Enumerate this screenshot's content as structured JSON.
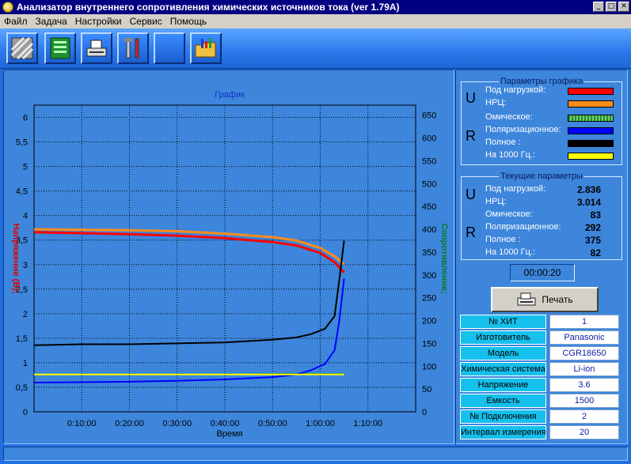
{
  "window": {
    "title": "Анализатор внутреннего сопротивления химических источников тока (ver 1.79А)"
  },
  "menu": [
    "Файл",
    "Задача",
    "Настройки",
    "Сервис",
    "Помощь"
  ],
  "toolbar": {
    "buttons": [
      "stripes-icon",
      "circuit-board-icon",
      "printer-fax-icon",
      "tools-icon",
      "blank-icon",
      "folder-chart-icon"
    ]
  },
  "graph": {
    "title": "График",
    "xlabel": "Время",
    "ylabel_left": "Напряжение (В);",
    "ylabel_right": "Сопротивление;"
  },
  "chart_data": {
    "type": "line",
    "title": "График",
    "xlabel": "Время",
    "ylabel": "Напряжение (В);",
    "y2label": "Сопротивление;",
    "x_ticks": [
      "0:10:00",
      "0:20:00",
      "0:30:00",
      "0:40:00",
      "0:50:00",
      "1:00:00",
      "1:10:00"
    ],
    "x_range_minutes": [
      0,
      80
    ],
    "y_ticks": [
      "0",
      "0,5",
      "1",
      "1,5",
      "2",
      "2,5",
      "3",
      "3,5",
      "4",
      "4,5",
      "5",
      "5,5",
      "6"
    ],
    "ylim": [
      0,
      6.25
    ],
    "y2_ticks": [
      "0",
      "50",
      "100",
      "150",
      "200",
      "250",
      "300",
      "350",
      "400",
      "450",
      "500",
      "550",
      "600",
      "650"
    ],
    "y2lim": [
      0,
      672
    ],
    "grid": true,
    "series": [
      {
        "name": "Под нагрузкой",
        "axis": "left",
        "color": "#ff0000",
        "x": [
          0,
          10,
          20,
          30,
          40,
          50,
          55,
          60,
          63,
          65
        ],
        "y": [
          3.66,
          3.64,
          3.62,
          3.59,
          3.54,
          3.46,
          3.39,
          3.24,
          3.05,
          2.84
        ]
      },
      {
        "name": "НРЦ",
        "axis": "left",
        "color": "#ff8c1a",
        "x": [
          0,
          10,
          20,
          30,
          40,
          50,
          55,
          60,
          63,
          65
        ],
        "y": [
          3.72,
          3.71,
          3.7,
          3.68,
          3.63,
          3.56,
          3.49,
          3.34,
          3.17,
          3.01
        ]
      },
      {
        "name": "Омическое",
        "axis": "right",
        "color": "#2a8a2a",
        "x": [
          0,
          10,
          20,
          30,
          40,
          50,
          60,
          65
        ],
        "y": [
          82,
          82,
          82,
          82,
          82,
          83,
          83,
          83
        ]
      },
      {
        "name": "Поляризационное",
        "axis": "right",
        "color": "#0000ff",
        "x": [
          0,
          10,
          20,
          30,
          40,
          50,
          55,
          58,
          61,
          63,
          64,
          65
        ],
        "y": [
          64,
          65,
          66,
          68,
          71,
          76,
          82,
          91,
          105,
          135,
          200,
          292
        ]
      },
      {
        "name": "Полное",
        "axis": "right",
        "color": "#000000",
        "x": [
          0,
          10,
          20,
          30,
          40,
          50,
          55,
          58,
          61,
          63,
          64,
          65
        ],
        "y": [
          146,
          148,
          148,
          150,
          152,
          158,
          163,
          170,
          182,
          210,
          290,
          375
        ]
      },
      {
        "name": "На 1000 Гц.",
        "axis": "right",
        "color": "#ffff00",
        "x": [
          0,
          10,
          20,
          30,
          40,
          50,
          60,
          65
        ],
        "y": [
          82,
          82,
          82,
          82,
          82,
          82,
          82,
          82
        ]
      }
    ]
  },
  "params_legend": {
    "title": "Параметры графика",
    "u": "U",
    "r": "R",
    "items": [
      {
        "label": "Под нагрузкой:",
        "color": "#ff0000"
      },
      {
        "label": "НРЦ:",
        "color": "#ff8c1a"
      },
      {
        "label": "Омическое:",
        "color": "#2a8a2a"
      },
      {
        "label": "Поляризационное:",
        "color": "#0000ff"
      },
      {
        "label": "Полное :",
        "color": "#000000"
      },
      {
        "label": "На 1000 Гц.:",
        "color": "#ffff00"
      }
    ]
  },
  "current": {
    "title": "Текущие параметры",
    "u": "U",
    "r": "R",
    "items": [
      {
        "label": "Под нагрузкой:",
        "value": "2.836"
      },
      {
        "label": "НРЦ:",
        "value": "3.014"
      },
      {
        "label": "Омическое:",
        "value": "83"
      },
      {
        "label": "Поляризационное:",
        "value": "292"
      },
      {
        "label": "Полное :",
        "value": "375"
      },
      {
        "label": "На 1000 Гц.:",
        "value": "82"
      }
    ]
  },
  "timer": "00:00:20",
  "print_label": "Печать",
  "info": [
    {
      "key": "№ ХИТ",
      "value": "1"
    },
    {
      "key": "Изготовитель",
      "value": "Panasonic"
    },
    {
      "key": "Модель",
      "value": "CGR18650"
    },
    {
      "key": "Химическая система",
      "value": "Li-ion"
    },
    {
      "key": "Напряжение",
      "value": "3.6"
    },
    {
      "key": "Емкость",
      "value": "1500"
    },
    {
      "key": "№ Подключения",
      "value": "2"
    },
    {
      "key": "Интервал измерения",
      "value": "20"
    }
  ]
}
